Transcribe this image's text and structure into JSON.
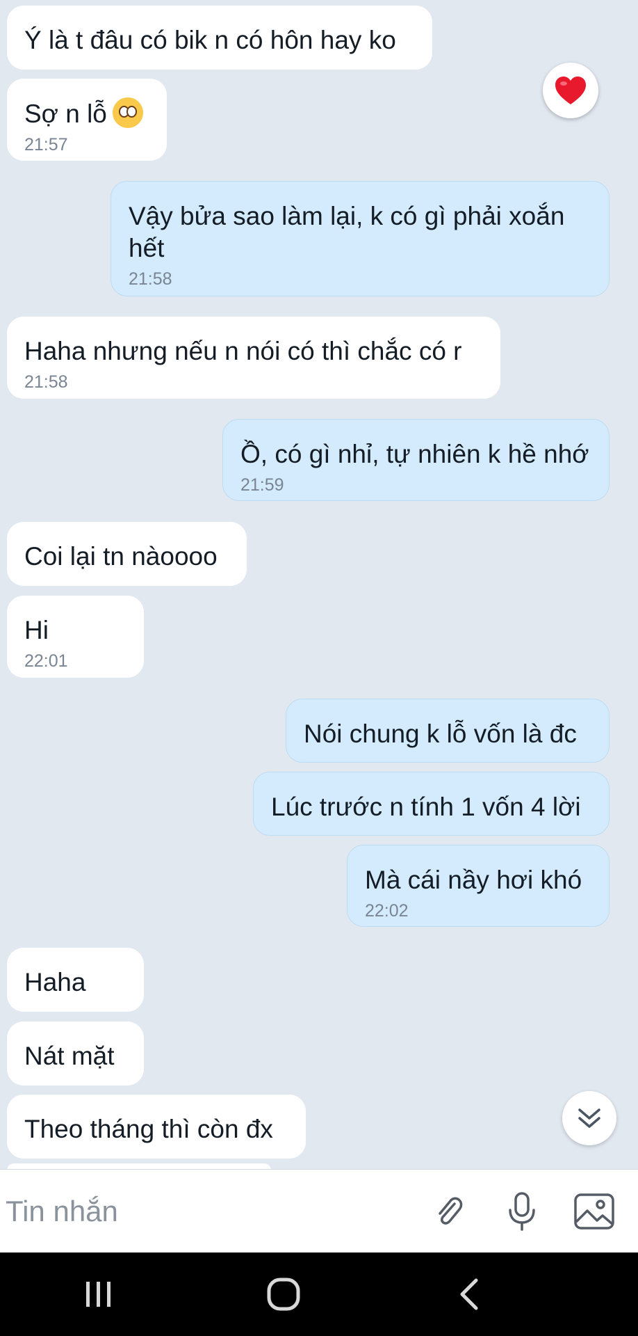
{
  "messages": [
    {
      "dir": "in",
      "text": "Ý là t đâu có bik n có hôn hay ko",
      "time": ""
    },
    {
      "dir": "in",
      "text": "Sợ n lỗ",
      "time": "21:57",
      "emoji": "flushed-face-icon"
    },
    {
      "dir": "out",
      "text": "Vậy bửa sao làm lại, k có gì phải xoắn hết",
      "time": "21:58"
    },
    {
      "dir": "in",
      "text": "Haha nhưng nếu n nói có thì chắc có r",
      "time": "21:58"
    },
    {
      "dir": "out",
      "text": "Ồ, có gì nhỉ, tự nhiên k hề nhớ",
      "time": "21:59"
    },
    {
      "dir": "in",
      "text": "Coi lại tn nàoooo",
      "time": ""
    },
    {
      "dir": "in",
      "text": "Hi",
      "time": "22:01"
    },
    {
      "dir": "out",
      "text": "Nói chung k lỗ vốn là đc",
      "time": ""
    },
    {
      "dir": "out",
      "text": "Lúc trước n tính 1 vốn 4 lời",
      "time": ""
    },
    {
      "dir": "out",
      "text": "Mà cái nầy hơi khó",
      "time": "22:02"
    },
    {
      "dir": "in",
      "text": "Haha",
      "time": ""
    },
    {
      "dir": "in",
      "text": "Nát mặt",
      "time": ""
    },
    {
      "dir": "in",
      "text": "Theo tháng thì còn đx",
      "time": ""
    }
  ],
  "reaction": {
    "icon": "heart-icon",
    "color": "#e8192c"
  },
  "input": {
    "placeholder": "Tin nhắn",
    "value": ""
  },
  "toolbar": {
    "icons": [
      "paperclip-icon",
      "microphone-icon",
      "image-icon"
    ]
  },
  "navbar": {
    "icons": [
      "recent-apps-icon",
      "home-icon",
      "back-icon"
    ]
  },
  "colors": {
    "background": "#e2e8f0",
    "incoming": "#ffffff",
    "outgoing": "#d3ebfc"
  }
}
